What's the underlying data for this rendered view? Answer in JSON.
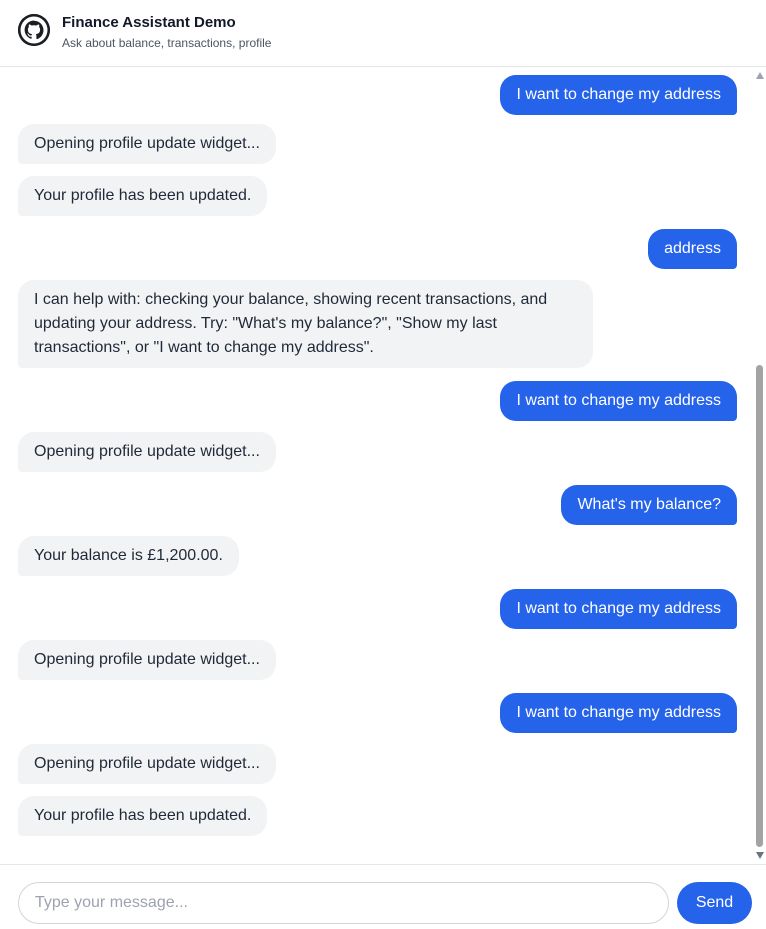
{
  "header": {
    "logo_icon": "github-icon",
    "title": "Finance Assistant Demo",
    "subtitle": "Ask about balance, transactions, profile"
  },
  "messages": [
    {
      "role": "user",
      "text": "I want to change my address"
    },
    {
      "role": "bot",
      "text": "Opening profile update widget..."
    },
    {
      "role": "bot",
      "text": "Your profile has been updated."
    },
    {
      "role": "user",
      "text": "address"
    },
    {
      "role": "bot",
      "text": "I can help with: checking your balance, showing recent transactions, and updating your address. Try: \"What's my balance?\", \"Show my last transactions\", or \"I want to change my address\"."
    },
    {
      "role": "user",
      "text": "I want to change my address"
    },
    {
      "role": "bot",
      "text": "Opening profile update widget..."
    },
    {
      "role": "user",
      "text": "What's my balance?"
    },
    {
      "role": "bot",
      "text": "Your balance is £1,200.00."
    },
    {
      "role": "user",
      "text": "I want to change my address"
    },
    {
      "role": "bot",
      "text": "Opening profile update widget..."
    },
    {
      "role": "user",
      "text": "I want to change my address"
    },
    {
      "role": "bot",
      "text": "Opening profile update widget..."
    },
    {
      "role": "bot",
      "text": "Your profile has been updated."
    }
  ],
  "composer": {
    "placeholder": "Type your message...",
    "value": "",
    "send_label": "Send"
  },
  "colors": {
    "accent": "#2563eb",
    "bot_bubble": "#f2f3f5"
  }
}
